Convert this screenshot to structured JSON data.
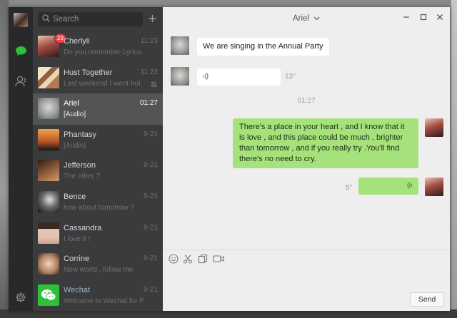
{
  "search": {
    "placeholder": "Search"
  },
  "conversations": [
    {
      "name": "Cherlyli",
      "preview": "Do you remember Lyrics…",
      "time": "11:23",
      "badge": "23",
      "avatar_color": "#c8746a"
    },
    {
      "name": "Hust Together",
      "preview": "Last weekend I went hol…",
      "time": "11:23",
      "avatar_color": "#d8c9a6"
    },
    {
      "name": "Ariel",
      "preview": "[Audio]",
      "time": "01:27",
      "avatar_color": "#9a9d99"
    },
    {
      "name": "Phantasy",
      "preview": "[Audio]",
      "time": "9-21",
      "avatar_color": "#c05a2a"
    },
    {
      "name": "Jefferson",
      "preview": "The other ?",
      "time": "9-21",
      "avatar_color": "#6d4a36"
    },
    {
      "name": "Bence",
      "preview": "how about tomorrow ?",
      "time": "9-21",
      "avatar_color": "#555555"
    },
    {
      "name": "Cassandra",
      "preview": "I love it !",
      "time": "9-21",
      "avatar_color": "#c9a090"
    },
    {
      "name": "Corrine",
      "preview": "New world , follow me",
      "time": "9-21",
      "avatar_color": "#b6866a"
    },
    {
      "name": "Wechat",
      "preview": "Welcome to Wechat for PC…",
      "time": "9-21",
      "avatar_color": "#2dc13a"
    }
  ],
  "chat": {
    "title": "Ariel",
    "messages": [
      {
        "text": "We are singing in the Annual Party"
      },
      {
        "duration": "13''"
      }
    ],
    "timestamp": "01:27",
    "outgoing": {
      "text": "There's a place in your heart , and I know that it is love , and this place could be much , brighter than tomorrow , and if you really try .You'll find there's no need to cry.",
      "duration": "5''"
    }
  },
  "actions": {
    "send": "Send"
  },
  "colors": {
    "accent_green": "#a6e27b",
    "nav_active_green": "#2dc13a",
    "badge_red": "#f04343",
    "sidebar": "#3a3b3d"
  },
  "icons": [
    "chat-bubble-icon",
    "contacts-icon",
    "settings-gear-icon",
    "emoji-icon",
    "scissors-icon",
    "file-icon",
    "video-call-icon",
    "voice-wave-icon",
    "mute-bell-icon"
  ]
}
